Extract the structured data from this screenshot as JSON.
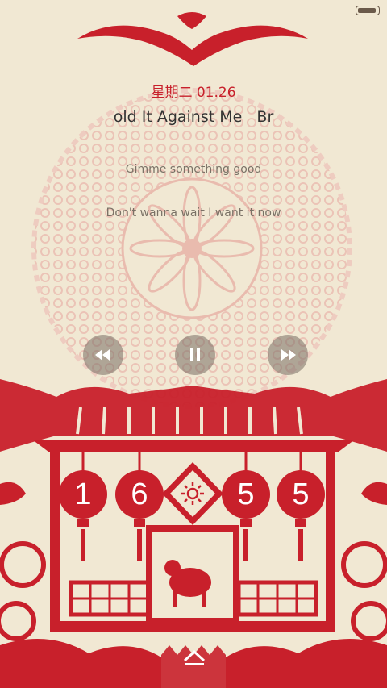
{
  "status_bar": {
    "battery_icon": "battery-icon",
    "battery_level": 0.9
  },
  "lockscreen": {
    "date": "星期二 01.26",
    "song_title": "old It Against Me   Br",
    "lyrics": [
      "Gimme something good",
      "Don't wanna wait I want it now"
    ],
    "controls": {
      "prev_icon": "rewind-icon",
      "pause_icon": "pause-icon",
      "next_icon": "fast-forward-icon"
    },
    "clock": {
      "h1": "1",
      "h2": "6",
      "m1": "5",
      "m2": "5",
      "sun_icon": "sun-icon"
    },
    "unlock_icon": "chevron-up-icon"
  },
  "colors": {
    "accent": "#c8202b",
    "background": "#f1e8d3"
  }
}
